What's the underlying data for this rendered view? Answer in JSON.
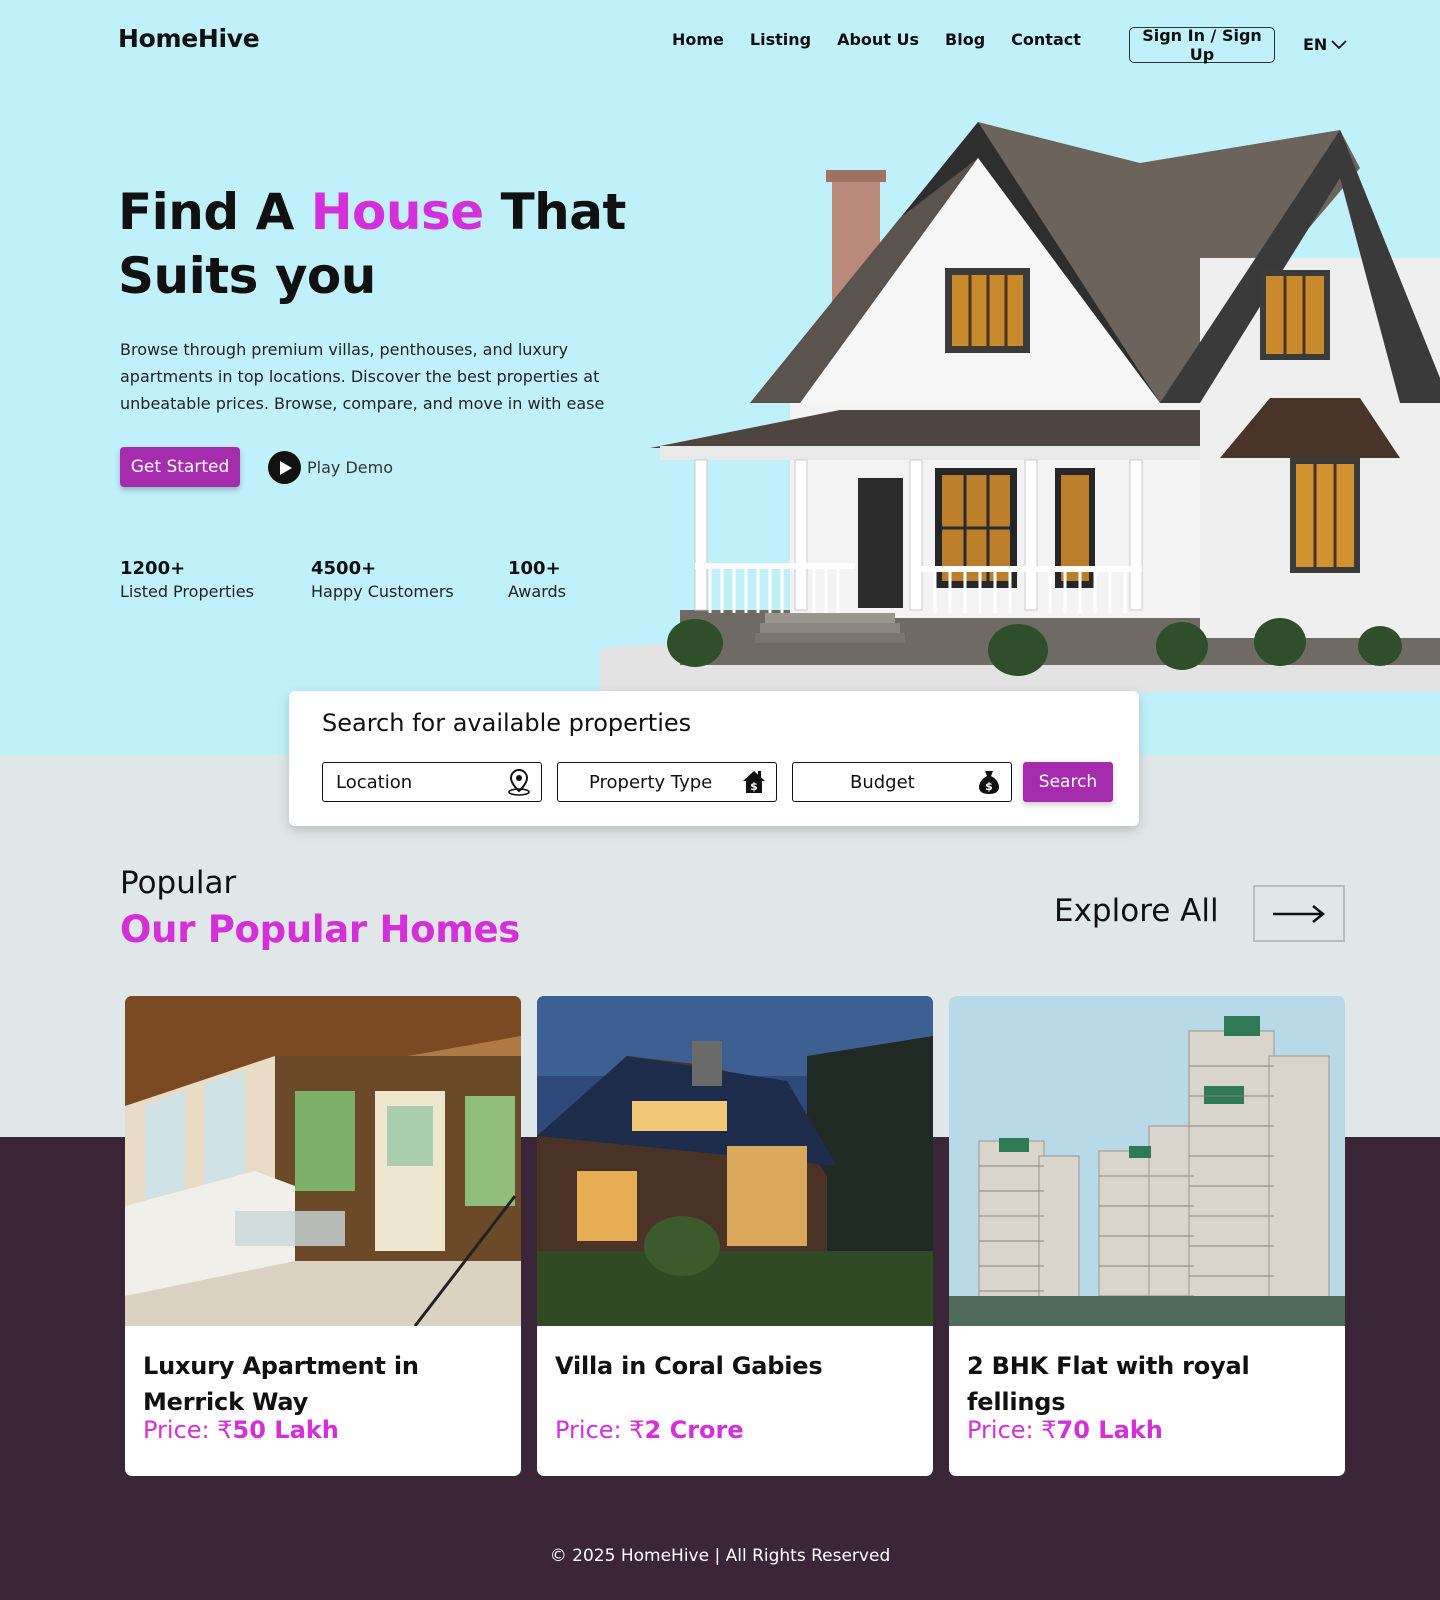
{
  "brand": {
    "name": "HomeHive"
  },
  "nav": {
    "items": [
      {
        "label": "Home"
      },
      {
        "label": "Listing"
      },
      {
        "label": "About Us"
      },
      {
        "label": "Blog"
      },
      {
        "label": "Contact"
      }
    ],
    "signin_label": "Sign In / Sign Up",
    "language": "EN"
  },
  "hero": {
    "title_part1": "Find A ",
    "title_accent": "House",
    "title_part2": " That Suits you",
    "description": "Browse through premium villas, penthouses, and luxury apartments in top locations. Discover the best properties at unbeatable prices. Browse, compare, and move in with ease",
    "cta_label": "Get Started",
    "demo_label": "Play Demo",
    "stats": [
      {
        "value": "1200+",
        "label": "Listed Properties"
      },
      {
        "value": "4500+",
        "label": "Happy Customers"
      },
      {
        "value": "100+",
        "label": "Awards"
      }
    ]
  },
  "search": {
    "title": "Search for available properties",
    "fields": [
      {
        "label": "Location",
        "icon": "location-pin-icon"
      },
      {
        "label": "Property Type",
        "icon": "house-dollar-icon"
      },
      {
        "label": "Budget",
        "icon": "money-bag-icon"
      }
    ],
    "button_label": "Search"
  },
  "popular": {
    "eyebrow": "Popular",
    "heading": "Our Popular Homes",
    "explore_label": "Explore All",
    "cards": [
      {
        "title": "Luxury Apartment in Merrick Way",
        "price_prefix": "Price: ₹",
        "price_value": "50 Lakh"
      },
      {
        "title": "Villa in Coral Gabies",
        "price_prefix": "Price: ₹",
        "price_value": "2 Crore"
      },
      {
        "title": "2 BHK Flat with royal fellings",
        "price_prefix": "Price: ₹",
        "price_value": "70 Lakh"
      }
    ]
  },
  "footer": {
    "text": "© 2025 HomeHive | All Rights Reserved"
  },
  "colors": {
    "accent": "#d42fd8",
    "button": "#a52cad",
    "hero_bg": "#c0f1fb",
    "section_bg": "#e0e7e8",
    "footer_bg": "#3b2539"
  }
}
